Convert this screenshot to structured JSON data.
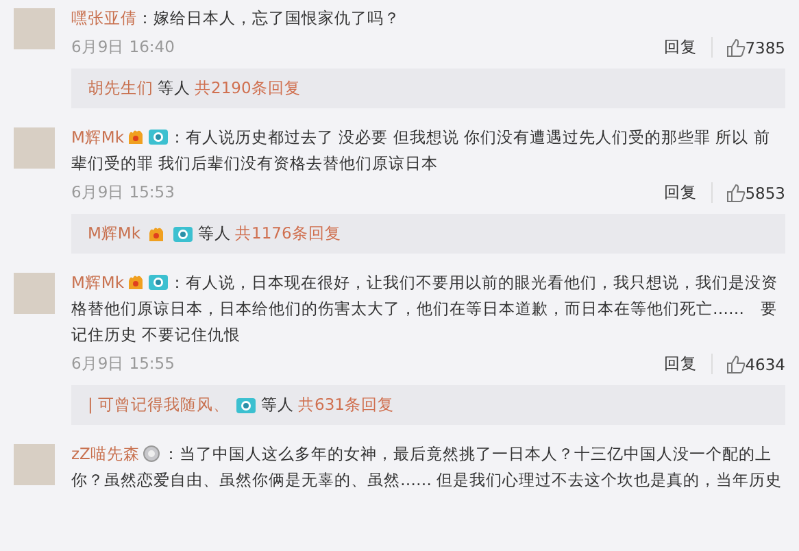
{
  "comments": [
    {
      "user": "嘿张亚倩",
      "text": "：嫁给日本人，忘了国恨家仇了吗？",
      "time": "6月9日 16:40",
      "reply_label": "回复",
      "likes": "7385",
      "replies": {
        "users": [
          {
            "name": "胡先生们"
          }
        ],
        "suffix": "等人",
        "count": "共2190条回复"
      }
    },
    {
      "user": "M辉Mk",
      "badges": [
        {
          "kind": "vip"
        },
        {
          "kind": "camera"
        }
      ],
      "text": "：有人说历史都过去了 没必要 但我想说 你们没有遭遇过先人们受的那些罪 所以 前辈们受的罪 我们后辈们没有资格去替他们原谅日本",
      "time": "6月9日 15:53",
      "reply_label": "回复",
      "likes": "5853",
      "replies": {
        "users": [
          {
            "name": "M辉Mk",
            "badges": [
              {
                "kind": "vip"
              },
              {
                "kind": "camera"
              }
            ]
          }
        ],
        "suffix": "等人",
        "count": "共1176条回复"
      }
    },
    {
      "user": "M辉Mk",
      "badges": [
        {
          "kind": "vip"
        },
        {
          "kind": "camera"
        }
      ],
      "text": "：有人说，日本现在很好，让我们不要用以前的眼光看他们，我只想说，我们是没资格替他们原谅日本，日本给他们的伤害太大了，他们在等日本道歉，而日本在等他们死亡……　要记住历史 不要记住仇恨",
      "time": "6月9日 15:55",
      "reply_label": "回复",
      "likes": "4634",
      "replies": {
        "users": [
          {
            "name": "| 可曾记得我随风、",
            "badges": [
              {
                "kind": "camera"
              }
            ]
          }
        ],
        "suffix": "等人",
        "count": "共631条回复"
      }
    },
    {
      "user": "zZ喵先森",
      "badges": [
        {
          "kind": "medal"
        }
      ],
      "text": "：当了中国人这么多年的女神，最后竟然挑了一日本人？十三亿中国人没一个配的上你？虽然恋爱自由、虽然你俩是无辜的、虽然…… 但是我们心理过不去这个坎也是真的，当年历史"
    }
  ]
}
